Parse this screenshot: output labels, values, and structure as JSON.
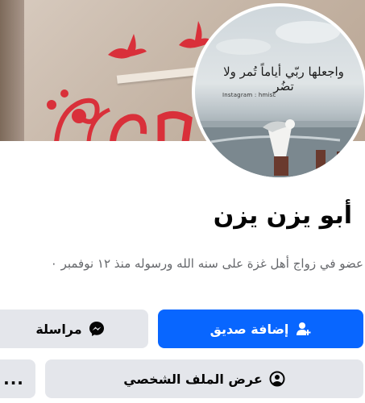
{
  "cover_photo": {
    "icon": "cover-photo-birds-wall-decal"
  },
  "profile_photo": {
    "quote": "واجعلها ربّي أياماً تُمر ولا تضُر",
    "instagram": "Instagram : hmisc",
    "icon": "seagull-photo"
  },
  "profile": {
    "name": "أبو يزن يزن",
    "bio": "عضو في زواج أهل غزة على سنه الله ورسوله منذ ١٢ نوفمبر ٠"
  },
  "actions": {
    "add_friend": {
      "label": "إضافة صديق",
      "icon": "add-friend-icon"
    },
    "message": {
      "label": "مراسلة",
      "icon": "messenger-icon"
    },
    "view_profile": {
      "label": "عرض الملف الشخصي",
      "icon": "profile-circle-icon"
    },
    "more": {
      "label": "..."
    }
  },
  "colors": {
    "primary": "#0866ff",
    "secondary_bg": "#e4e6eb",
    "text": "#050505",
    "muted": "#65676b",
    "decal_red": "#d9303a"
  }
}
